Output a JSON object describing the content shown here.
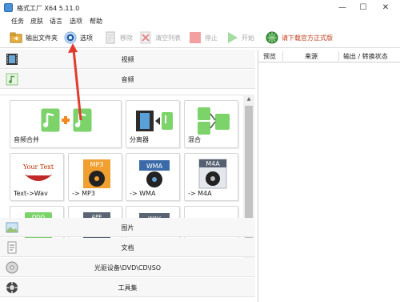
{
  "window": {
    "title": "格式工厂 X64 5.11.0",
    "minimize": "—",
    "maximize": "☐",
    "close": "✕"
  },
  "menu": [
    "任务",
    "皮肤",
    "语言",
    "选项",
    "帮助"
  ],
  "toolbar": {
    "output_folder": "输出文件夹",
    "options": "选项",
    "remove": "移除",
    "clear_list": "清空列表",
    "stop": "停止",
    "start": "开始",
    "download": "请下载官方正式版"
  },
  "categories": {
    "video": "视频",
    "audio": "音频",
    "image": "图片",
    "document": "文档",
    "disc": "光驱设备\\DVD\\CD\\ISO",
    "tools": "工具集"
  },
  "tiles": [
    {
      "label": "音频合并",
      "icon": "audio-merge-icon"
    },
    {
      "label": "分离器",
      "icon": "splitter-icon"
    },
    {
      "label": "混合",
      "icon": "mix-icon"
    },
    {
      "label": "Text->Wav",
      "icon": "text-to-wav-icon",
      "badge": "Your Text"
    },
    {
      "label": "-> MP3",
      "icon": "mp3-icon",
      "badge": "MP3"
    },
    {
      "label": "-> WMA",
      "icon": "wma-icon",
      "badge": "WMA"
    },
    {
      "label": "-> M4A",
      "icon": "m4a-icon",
      "badge": "M4A"
    },
    {
      "label": "",
      "icon": "ogg-icon",
      "badge": "OGG"
    },
    {
      "label": "",
      "icon": "ape-icon",
      "badge": "APE"
    },
    {
      "label": "",
      "icon": "wav-icon",
      "badge": "WAV"
    },
    {
      "label": "",
      "icon": "blank-icon"
    }
  ],
  "task_columns": [
    "预览",
    "来源",
    "输出 / 转换状态"
  ],
  "colors": {
    "accent_green": "#5cc24a",
    "accent_orange": "#f0a030",
    "arrow_red": "#e23b2e",
    "disc_dark": "#2a2a2a"
  }
}
